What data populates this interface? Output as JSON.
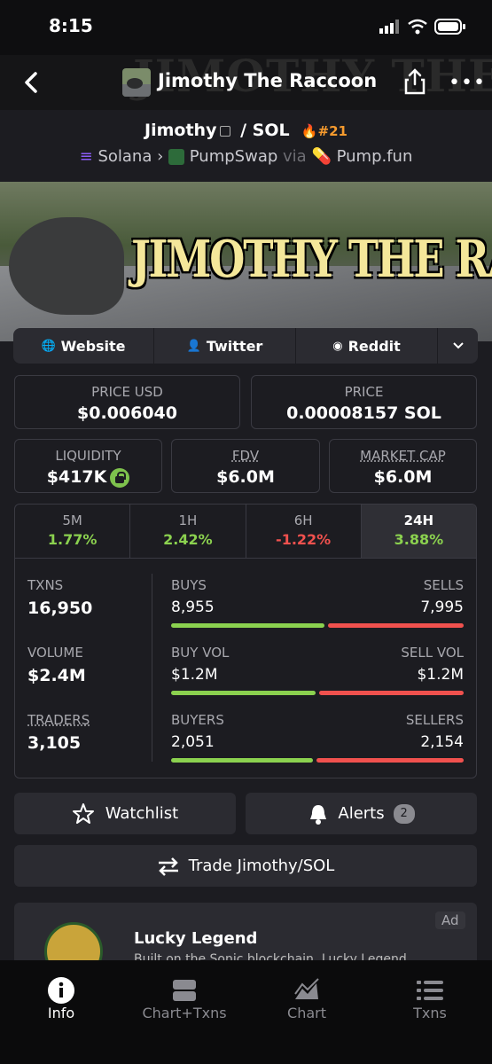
{
  "status": {
    "time": "8:15"
  },
  "header": {
    "title": "Jimothy The Raccoon",
    "bg_text": "JIMOTHY THE RACCOON"
  },
  "pair": {
    "base": "Jimothy",
    "quote": "/ SOL",
    "rank": "#21",
    "chain": "Solana",
    "dex": "PumpSwap",
    "via": "via",
    "launchpad": "Pump.fun"
  },
  "banner": {
    "title": "JIMOTHY THE RACCOON"
  },
  "links": {
    "website": "Website",
    "twitter": "Twitter",
    "reddit": "Reddit"
  },
  "price": {
    "usd_label": "PRICE USD",
    "usd": "$0.006040",
    "native_label": "PRICE",
    "native": "0.00008157 SOL"
  },
  "metrics": {
    "liq_label": "LIQUIDITY",
    "liq": "$417K",
    "fdv_label": "FDV",
    "fdv": "$6.0M",
    "mc_label": "MARKET CAP",
    "mc": "$6.0M"
  },
  "timeframes": [
    {
      "name": "5M",
      "pct": "1.77%"
    },
    {
      "name": "1H",
      "pct": "2.42%"
    },
    {
      "name": "6H",
      "pct": "-1.22%"
    },
    {
      "name": "24H",
      "pct": "3.88%"
    }
  ],
  "stats": {
    "txns_label": "TXNS",
    "txns": "16,950",
    "volume_label": "VOLUME",
    "volume": "$2.4M",
    "traders_label": "TRADERS",
    "traders": "3,105",
    "buys_label": "BUYS",
    "buys": "8,955",
    "sells_label": "SELLS",
    "sells": "7,995",
    "buyvol_label": "BUY VOL",
    "buyvol": "$1.2M",
    "sellvol_label": "SELL VOL",
    "sellvol": "$1.2M",
    "buyers_label": "BUYERS",
    "buyers": "2,051",
    "sellers_label": "SELLERS",
    "sellers": "2,154",
    "buy_share": 0.53,
    "buyvol_share": 0.5,
    "buyers_share": 0.49
  },
  "actions": {
    "watchlist": "Watchlist",
    "alerts": "Alerts",
    "alerts_count": "2",
    "trade": "Trade Jimothy/SOL"
  },
  "ad": {
    "name": "Lucky Legend",
    "tag": "Ad",
    "desc": "Built on the Sonic blockchain, Lucky Legend"
  },
  "tabs": {
    "info": "Info",
    "chart_txns": "Chart+Txns",
    "chart": "Chart",
    "txns": "Txns"
  },
  "colors": {
    "positive": "#8bd14f",
    "negative": "#f0514e",
    "rank": "#f59a2e"
  }
}
